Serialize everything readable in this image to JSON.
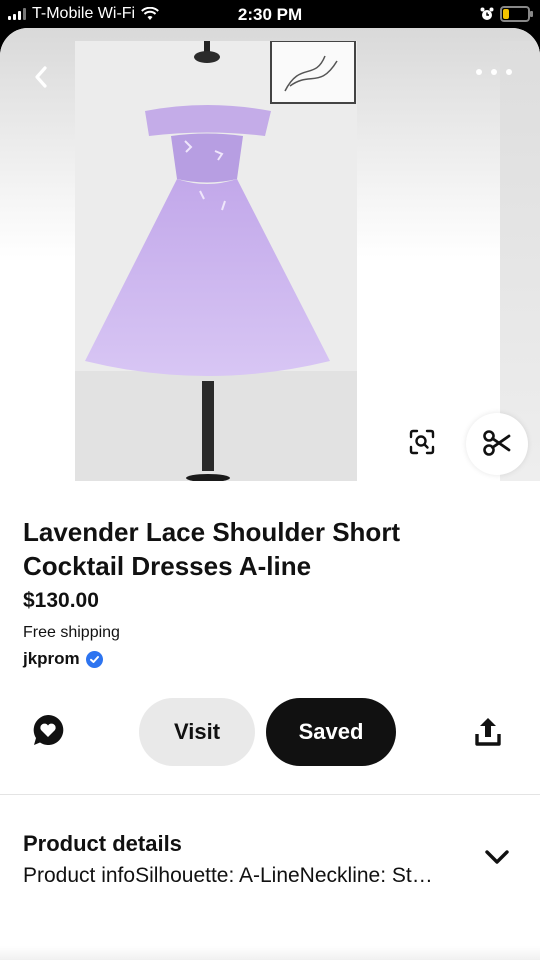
{
  "status_bar": {
    "carrier": "T-Mobile Wi-Fi",
    "time": "2:30 PM",
    "battery_level": 0.25,
    "battery_color": "#f4c300"
  },
  "pin": {
    "title": "Lavender Lace Shoulder Short Cocktail Dresses A-line",
    "price": "$130.00",
    "shipping": "Free shipping",
    "seller": "jkprom",
    "seller_verified": true,
    "image_description_icon": "dress-photo"
  },
  "actions": {
    "visit_label": "Visit",
    "saved_label": "Saved",
    "comment_icon": "comment-heart-icon",
    "share_icon": "share-icon"
  },
  "overlay": {
    "back_icon": "back-chevron-icon",
    "more_icon": "more-dots-icon",
    "visual_search_icon": "visual-search-icon",
    "cut_icon": "scissors-icon"
  },
  "details": {
    "heading": "Product details",
    "body": "Product infoSilhouette: A-LineNeckline: St…",
    "expand_icon": "chevron-down-icon"
  },
  "colors": {
    "accent_dark": "#111111",
    "visit_bg": "#e9e9e9",
    "verified_blue": "#2d74f0",
    "dress_lavender": "#c9b3ec"
  }
}
